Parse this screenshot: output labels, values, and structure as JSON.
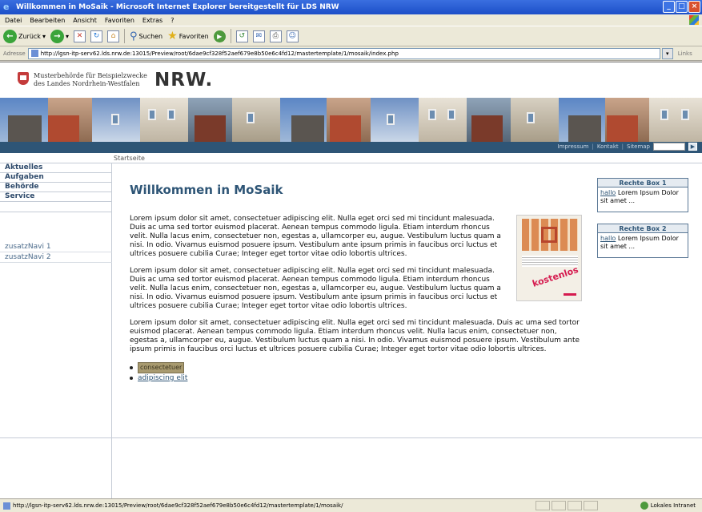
{
  "window": {
    "title": "Willkommen in MoSaik - Microsoft Internet Explorer bereitgestellt für LDS NRW",
    "controls": [
      "_",
      "□",
      "×"
    ]
  },
  "menu": [
    "Datei",
    "Bearbeiten",
    "Ansicht",
    "Favoriten",
    "Extras",
    "?"
  ],
  "toolbar": {
    "back_label": "Zurück",
    "search_label": "Suchen",
    "favorites_label": "Favoriten"
  },
  "address": {
    "label": "Adresse",
    "url": "http://lgsn-itp-serv62.lds.nrw.de:13015/Preview/root/6dae9cf328f52aef679e8b50e6c4fd12/mastertemplate/1/mosaik/index.php",
    "links_label": "Links"
  },
  "site": {
    "authority_line1": "Musterbehörde für Beispielzwecke",
    "authority_line2": "des Landes Nordrhein-Westfalen",
    "logo": "NRW.",
    "meta_nav": [
      "Impressum",
      "Kontakt",
      "Sitemap"
    ],
    "breadcrumb": "Startseite"
  },
  "nav": {
    "items": [
      "Aktuelles",
      "Aufgaben",
      "Behörde",
      "Service"
    ],
    "extra": [
      "zusatzNavi 1",
      "zusatzNavi 2"
    ]
  },
  "main": {
    "title": "Willkommen in MoSaik",
    "paragraphs": [
      "Lorem ipsum dolor sit amet, consectetuer adipiscing elit. Nulla eget orci sed mi tincidunt malesuada. Duis ac uma sed tortor euismod placerat. Aenean tempus commodo ligula. Etiam interdum rhoncus velit. Nulla lacus enim, consectetuer non, egestas a, ullamcorper eu, augue. Vestibulum luctus quam a nisi. In odio. Vivamus euismod posuere ipsum. Vestibulum ante ipsum primis in faucibus orci luctus et ultrices posuere cubilia Curae; Integer eget tortor vitae odio lobortis ultrices.",
      "Lorem ipsum dolor sit amet, consectetuer adipiscing elit. Nulla eget orci sed mi tincidunt malesuada. Duis ac uma sed tortor euismod placerat. Aenean tempus commodo ligula. Etiam interdum rhoncus velit. Nulla lacus enim, consectetuer non, egestas a, ullamcorper eu, augue. Vestibulum luctus quam a nisi. In odio. Vivamus euismod posuere ipsum. Vestibulum ante ipsum primis in faucibus orci luctus et ultrices posuere cubilia Curae; Integer eget tortor vitae odio lobortis ultrices.",
      "Lorem ipsum dolor sit amet, consectetuer adipiscing elit. Nulla eget orci sed mi tincidunt malesuada. Duis ac uma sed tortor euismod placerat. Aenean tempus commodo ligula. Etiam interdum rhoncus velit. Nulla lacus enim, consectetuer non, egestas a, ullamcorper eu, augue. Vestibulum luctus quam a nisi. In odio. Vivamus euismod posuere ipsum. Vestibulum ante ipsum primis in faucibus orci luctus et ultrices posuere cubilia Curae; Integer eget tortor vitae odio lobortis ultrices."
    ],
    "teaser_stamp": "kostenlos",
    "links": [
      "consectetuer",
      "adipiscing elit"
    ]
  },
  "right": {
    "boxes": [
      {
        "title": "Rechte Box 1",
        "link": "hallo",
        "text": " Lorem Ipsum Dolor sit amet ..."
      },
      {
        "title": "Rechte Box 2",
        "link": "hallo",
        "text": " Lorem Ipsum Dolor sit amet ..."
      }
    ]
  },
  "status": {
    "url": "http://lgsn-itp-serv62.lds.nrw.de:13015/Preview/root/6dae9cf328f52aef679e8b50e6c4fd12/mastertemplate/1/mosaik/",
    "zone": "Lokales Intranet"
  }
}
